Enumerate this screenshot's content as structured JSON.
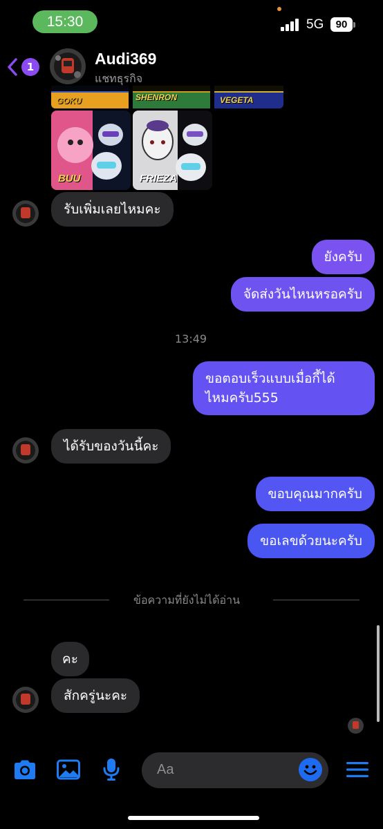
{
  "status_bar": {
    "time": "15:30",
    "network": "5G",
    "battery": "90"
  },
  "header": {
    "back_badge": "1",
    "name": "Audi369",
    "subtitle": "แชทธุรกิจ"
  },
  "images": {
    "strip_labels": [
      "GOKU",
      "SHENRON",
      "VEGETA"
    ],
    "tile_a_label": "BUU",
    "tile_b_label": "FRIEZA"
  },
  "messages": {
    "m1": "รับเพิ่มเลยไหมคะ",
    "m2": "ยังครับ",
    "m3": "จัดส่งวันไหนหรอครับ",
    "timestamp": "13:49",
    "m4_line1": "ขอตอบเร็วแบบเมื่อกี้ได้",
    "m4_line2": "ไหมครับ555",
    "m5": "ได้รับของวันนี้คะ",
    "m6": "ขอบคุณมากครับ",
    "m7": "ขอเลขด้วยนะครับ",
    "unread_divider": "ข้อความที่ยังไม่ได้อ่าน",
    "m8": "คะ",
    "m9": "สักครู่นะคะ"
  },
  "composer": {
    "placeholder": "Aa"
  },
  "colors": {
    "accent": "#0a7cff",
    "outgoing_top": "#7a52f0",
    "outgoing_bottom": "#4a56f2",
    "incoming": "#2a2a2c"
  }
}
